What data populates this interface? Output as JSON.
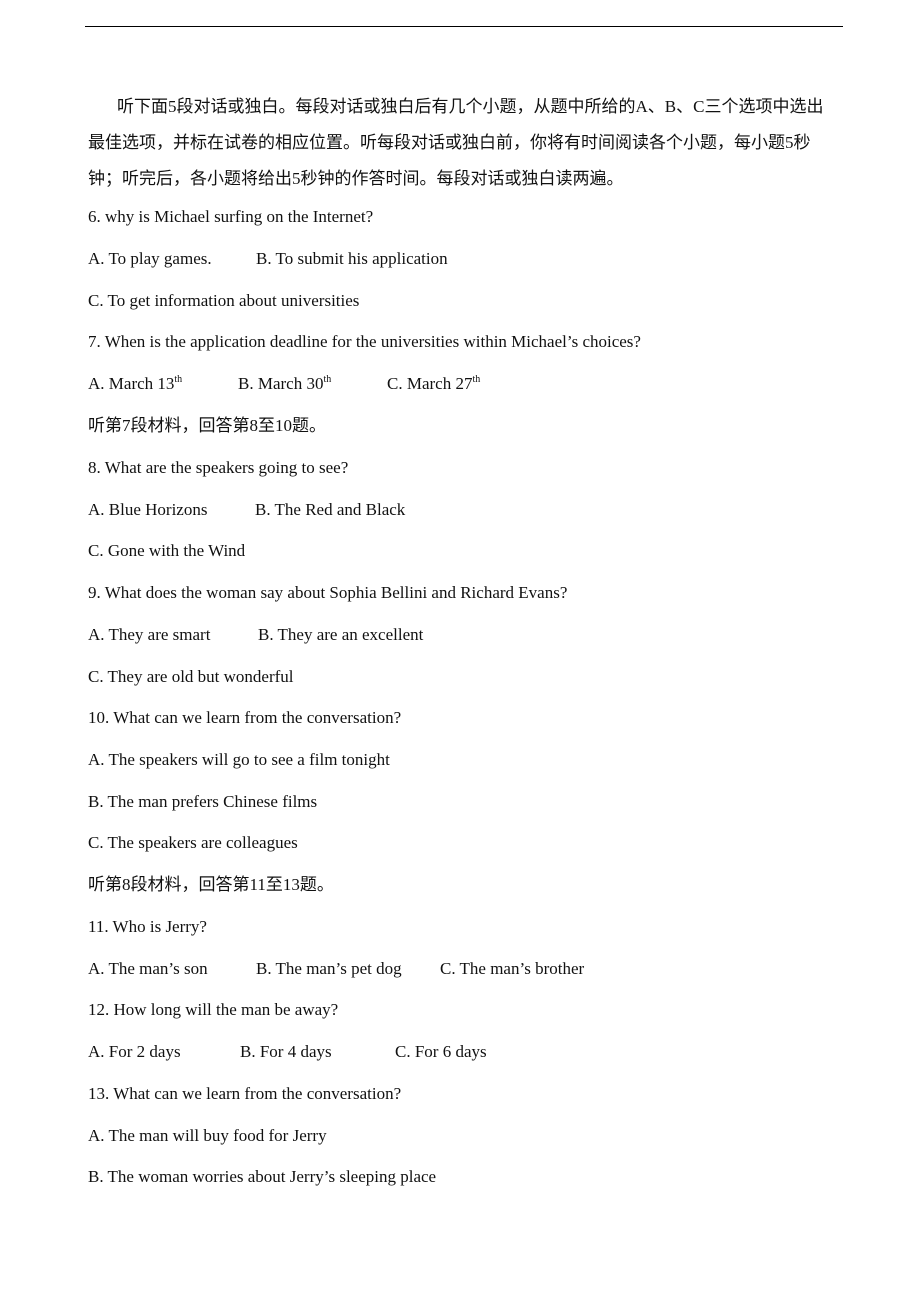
{
  "document": {
    "intro": "听下面5段对话或独白。每段对话或独白后有几个小题，从题中所给的A、B、C三个选项中选出最佳选项，并标在试卷的相应位置。听每段对话或独白前，你将有时间阅读各个小题，每小题5秒钟；听完后，各小题将给出5秒钟的作答时间。每段对话或独白读两遍。",
    "q6": {
      "question": "6. why is Michael surfing on the Internet?",
      "a": "A. To play games.",
      "b": "B. To submit his application",
      "c": "C. To get information about universities"
    },
    "q7": {
      "question": "7. When is the application deadline for the universities within Michael’s choices?",
      "a": "A. March 13",
      "b": "B. March 30",
      "c": "C. March 27",
      "suffix": "th"
    },
    "section7": "听第7段材料，回答第8至10题。",
    "q8": {
      "question": "8. What are the speakers going to see?",
      "a": "A. Blue Horizons",
      "b": "B. The Red and Black",
      "c": "C. Gone with the Wind"
    },
    "q9": {
      "question": "9. What does the woman say about Sophia Bellini and Richard Evans?",
      "a": "A. They are smart",
      "b": "B. They are an excellent",
      "c": "C. They are old but wonderful"
    },
    "q10": {
      "question": "10. What can we learn from the conversation?",
      "a": "A. The speakers will go to see a film tonight",
      "b": "B. The man prefers Chinese films",
      "c": "C. The speakers are colleagues"
    },
    "section8": "听第8段材料，回答第11至13题。",
    "q11": {
      "question": "11. Who is Jerry?",
      "a": "A. The man’s son",
      "b": "B. The man’s pet dog",
      "c": "C. The man’s brother"
    },
    "q12": {
      "question": "12. How long will the man be away?",
      "a": "A. For 2 days",
      "b": "B. For 4 days",
      "c": "C. For 6 days"
    },
    "q13": {
      "question": "13. What can we learn from the conversation?",
      "a": "A. The man will buy food for Jerry",
      "b": "B. The woman worries about Jerry’s sleeping place"
    }
  }
}
